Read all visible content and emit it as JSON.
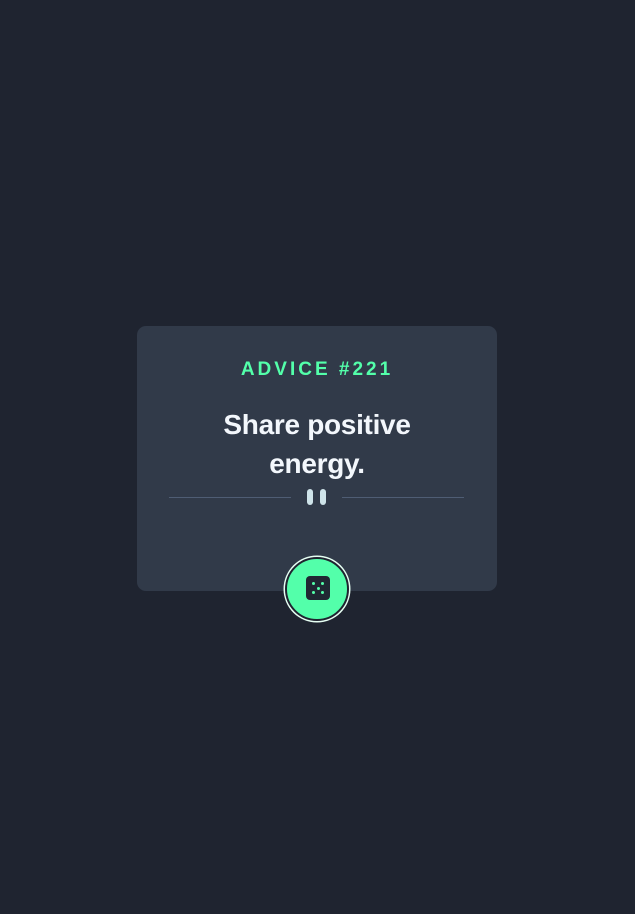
{
  "card": {
    "advice_id": "ADVICE #221",
    "advice_text": "Share positive energy."
  },
  "icons": {
    "divider": "pause-icon",
    "button": "dice-icon"
  },
  "colors": {
    "background": "#1f2430",
    "card": "#313a49",
    "accent": "#53ffaa",
    "text": "#f3f7fc"
  }
}
